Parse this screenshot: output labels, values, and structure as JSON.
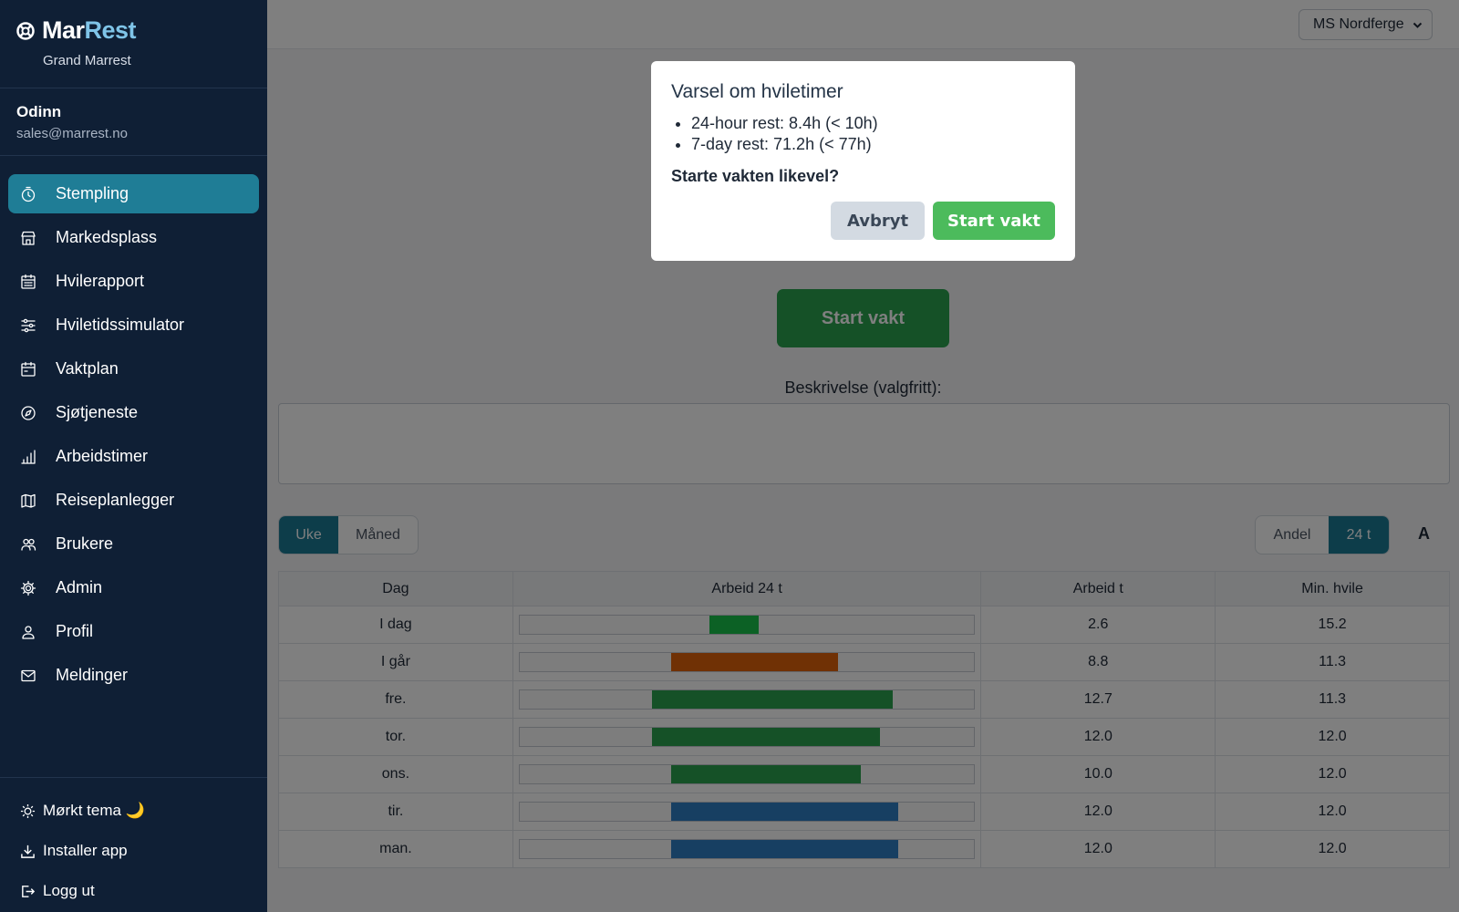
{
  "brand": {
    "name_a": "Mar",
    "name_b": "Rest",
    "subtitle": "Grand Marrest"
  },
  "user": {
    "name": "Odinn",
    "email": "sales@marrest.no"
  },
  "nav": [
    {
      "label": "Stempling",
      "icon": "stopwatch-icon",
      "active": true
    },
    {
      "label": "Markedsplass",
      "icon": "store-icon",
      "active": false
    },
    {
      "label": "Hvilerapport",
      "icon": "calendar-grid-icon",
      "active": false
    },
    {
      "label": "Hviletidssimulator",
      "icon": "sliders-icon",
      "active": false
    },
    {
      "label": "Vaktplan",
      "icon": "calendar-icon",
      "active": false
    },
    {
      "label": "Sjøtjeneste",
      "icon": "compass-icon",
      "active": false
    },
    {
      "label": "Arbeidstimer",
      "icon": "bar-chart-icon",
      "active": false
    },
    {
      "label": "Reiseplanlegger",
      "icon": "map-icon",
      "active": false
    },
    {
      "label": "Brukere",
      "icon": "users-icon",
      "active": false
    },
    {
      "label": "Admin",
      "icon": "gear-icon",
      "active": false
    },
    {
      "label": "Profil",
      "icon": "user-icon",
      "active": false
    },
    {
      "label": "Meldinger",
      "icon": "envelope-icon",
      "active": false
    }
  ],
  "sidebar_bottom": {
    "theme": "Mørkt tema 🌙",
    "install": "Installer app",
    "logout": "Logg ut"
  },
  "topbar": {
    "vessel": "MS Nordferge"
  },
  "main": {
    "start_button": "Start vakt",
    "description_label": "Beskrivelse (valgfritt):",
    "description_value": "",
    "period_toggle": [
      {
        "label": "Uke",
        "on": true
      },
      {
        "label": "Måned",
        "on": false
      }
    ],
    "view_toggle": [
      {
        "label": "Andel",
        "on": false
      },
      {
        "label": "24 t",
        "on": true
      }
    ],
    "font_toggle": "A"
  },
  "table": {
    "headers": [
      "Dag",
      "Arbeid 24 t",
      "Arbeid t",
      "Min. hvile"
    ],
    "rows": [
      {
        "day": "I dag",
        "work": "2.6",
        "rest": "15.2",
        "bar_start": 0.417,
        "bar_end": 0.525,
        "color": "#19c24a"
      },
      {
        "day": "I går",
        "work": "8.8",
        "rest": "11.3",
        "bar_start": 0.333,
        "bar_end": 0.7,
        "color": "#e0620b"
      },
      {
        "day": "fre.",
        "work": "12.7",
        "rest": "11.3",
        "bar_start": 0.292,
        "bar_end": 0.82,
        "color": "#2aa24f"
      },
      {
        "day": "tor.",
        "work": "12.0",
        "rest": "12.0",
        "bar_start": 0.292,
        "bar_end": 0.792,
        "color": "#2aa24f"
      },
      {
        "day": "ons.",
        "work": "10.0",
        "rest": "12.0",
        "bar_start": 0.333,
        "bar_end": 0.75,
        "color": "#2aa24f"
      },
      {
        "day": "tir.",
        "work": "12.0",
        "rest": "12.0",
        "bar_start": 0.333,
        "bar_end": 0.833,
        "color": "#2f7fc4"
      },
      {
        "day": "man.",
        "work": "12.0",
        "rest": "12.0",
        "bar_start": 0.333,
        "bar_end": 0.833,
        "color": "#2f7fc4"
      }
    ]
  },
  "modal": {
    "title": "Varsel om hviletimer",
    "items": [
      "24-hour rest: 8.4h (< 10h)",
      "7-day rest: 71.2h (< 77h)"
    ],
    "question": "Starte vakten likevel?",
    "cancel": "Avbryt",
    "confirm": "Start vakt"
  }
}
